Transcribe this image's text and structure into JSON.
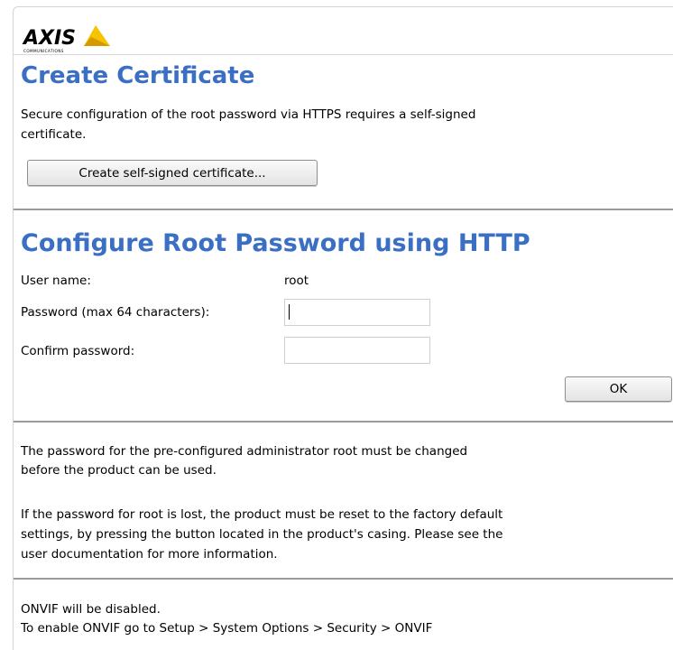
{
  "brand": {
    "name": "AXIS",
    "sub": "COMMUNICATIONS"
  },
  "create_certificate": {
    "title": "Create Certificate",
    "description_line1": "Secure configuration of the root password via HTTPS requires a self-signed",
    "description_line2": "certificate.",
    "button_label": "Create self-signed certificate..."
  },
  "configure_http": {
    "title": "Configure Root Password using HTTP",
    "username_label": "User name:",
    "username_value": "root",
    "password_label": "Password (max 64 characters):",
    "password_value": "",
    "confirm_label": "Confirm password:",
    "confirm_value": "",
    "ok_label": "OK"
  },
  "notes": {
    "change_line1": "The password for the pre-configured administrator root must be changed",
    "change_line2": "before the product can be used.",
    "lost_line1": "If the password for root is lost, the product must be reset to the factory default",
    "lost_line2": "settings, by pressing the button located in the product's casing. Please see the",
    "lost_line3": "user documentation for more information."
  },
  "onvif": {
    "line1": "ONVIF will be disabled.",
    "line2": "To enable ONVIF go to Setup > System Options > Security > ONVIF"
  },
  "colors": {
    "heading": "#3a6fc4",
    "logo_yellow": "#f6c300",
    "rule": "#9a9a9a"
  }
}
